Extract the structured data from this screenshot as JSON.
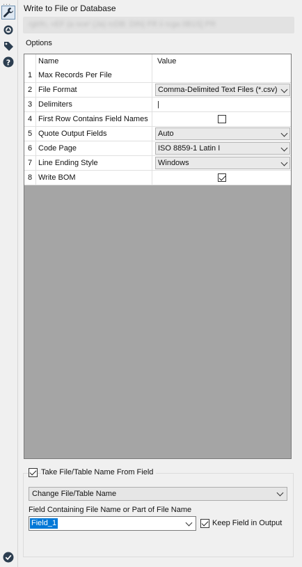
{
  "panel": {
    "title": "Write to File or Database",
    "connection_blurred": "rgtrfn, «EF (a nce¹ (Ja) rcDB: DIN) FR ii rcga 0B1S] PR",
    "options_label": "Options"
  },
  "toolbar": {
    "icons": [
      "wrench-icon",
      "target-icon",
      "tag-icon",
      "help-icon"
    ],
    "dots": "..."
  },
  "grid": {
    "header_name": "Name",
    "header_value": "Value",
    "rows": [
      {
        "num": "1",
        "name": "Max Records Per File",
        "value": "",
        "kind": "text"
      },
      {
        "num": "2",
        "name": "File Format",
        "value": "Comma-Delimited Text Files (*.csv)",
        "kind": "dropdown"
      },
      {
        "num": "3",
        "name": "Delimiters",
        "value": "|",
        "kind": "text"
      },
      {
        "num": "4",
        "name": "First Row Contains Field Names",
        "value": false,
        "kind": "checkbox"
      },
      {
        "num": "5",
        "name": "Quote Output Fields",
        "value": "Auto",
        "kind": "dropdown"
      },
      {
        "num": "6",
        "name": "Code Page",
        "value": "ISO 8859-1 Latin I",
        "kind": "dropdown"
      },
      {
        "num": "7",
        "name": "Line Ending Style",
        "value": "Windows",
        "kind": "dropdown"
      },
      {
        "num": "8",
        "name": "Write BOM",
        "value": true,
        "kind": "checkbox"
      }
    ]
  },
  "name_from_field": {
    "checkbox_label": "Take File/Table Name From Field",
    "checked": true,
    "mode_value": "Change File/Table Name",
    "field_label": "Field Containing File Name or Part of File Name",
    "field_value": "Field_1",
    "keep_label": "Keep Field in Output",
    "keep_checked": true
  },
  "status": {
    "icon": "checkmark-circle-icon"
  }
}
